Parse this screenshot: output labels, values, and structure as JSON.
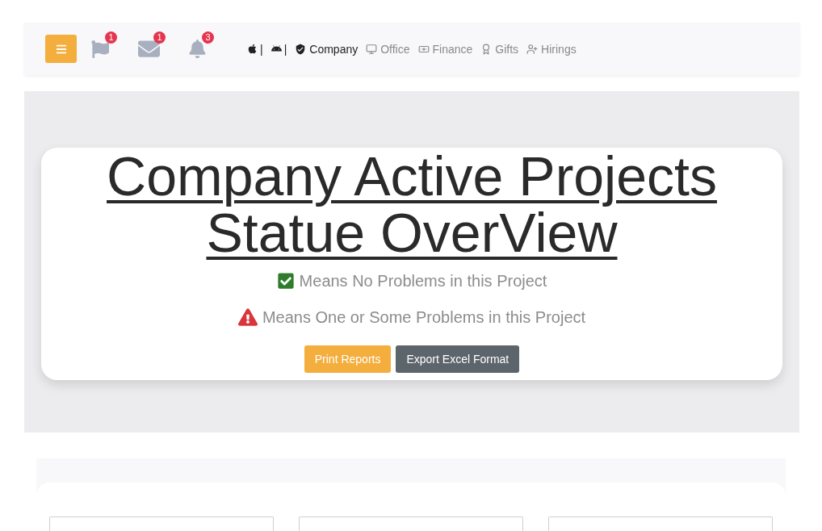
{
  "navbar": {
    "notifications": [
      {
        "count": "1"
      },
      {
        "count": "1"
      },
      {
        "count": "3"
      }
    ],
    "platforms": [
      {
        "separator": "|"
      },
      {
        "separator": "|"
      }
    ],
    "links": [
      {
        "label": "Company",
        "selected": true
      },
      {
        "label": "Office",
        "selected": false
      },
      {
        "label": "Finance",
        "selected": false
      },
      {
        "label": "Gifts",
        "selected": false
      },
      {
        "label": "Hirings",
        "selected": false
      }
    ]
  },
  "hero": {
    "title": "Company Active Projects Statue OverView",
    "legend": [
      {
        "kind": "ok",
        "text": "Means No Problems in this Project"
      },
      {
        "kind": "problem",
        "text": "Means One or Some Problems in this Project"
      }
    ],
    "buttons": [
      {
        "kind": "warning",
        "label": "Print Reports"
      },
      {
        "kind": "secondary",
        "label": "Export Excel Format"
      }
    ]
  }
}
